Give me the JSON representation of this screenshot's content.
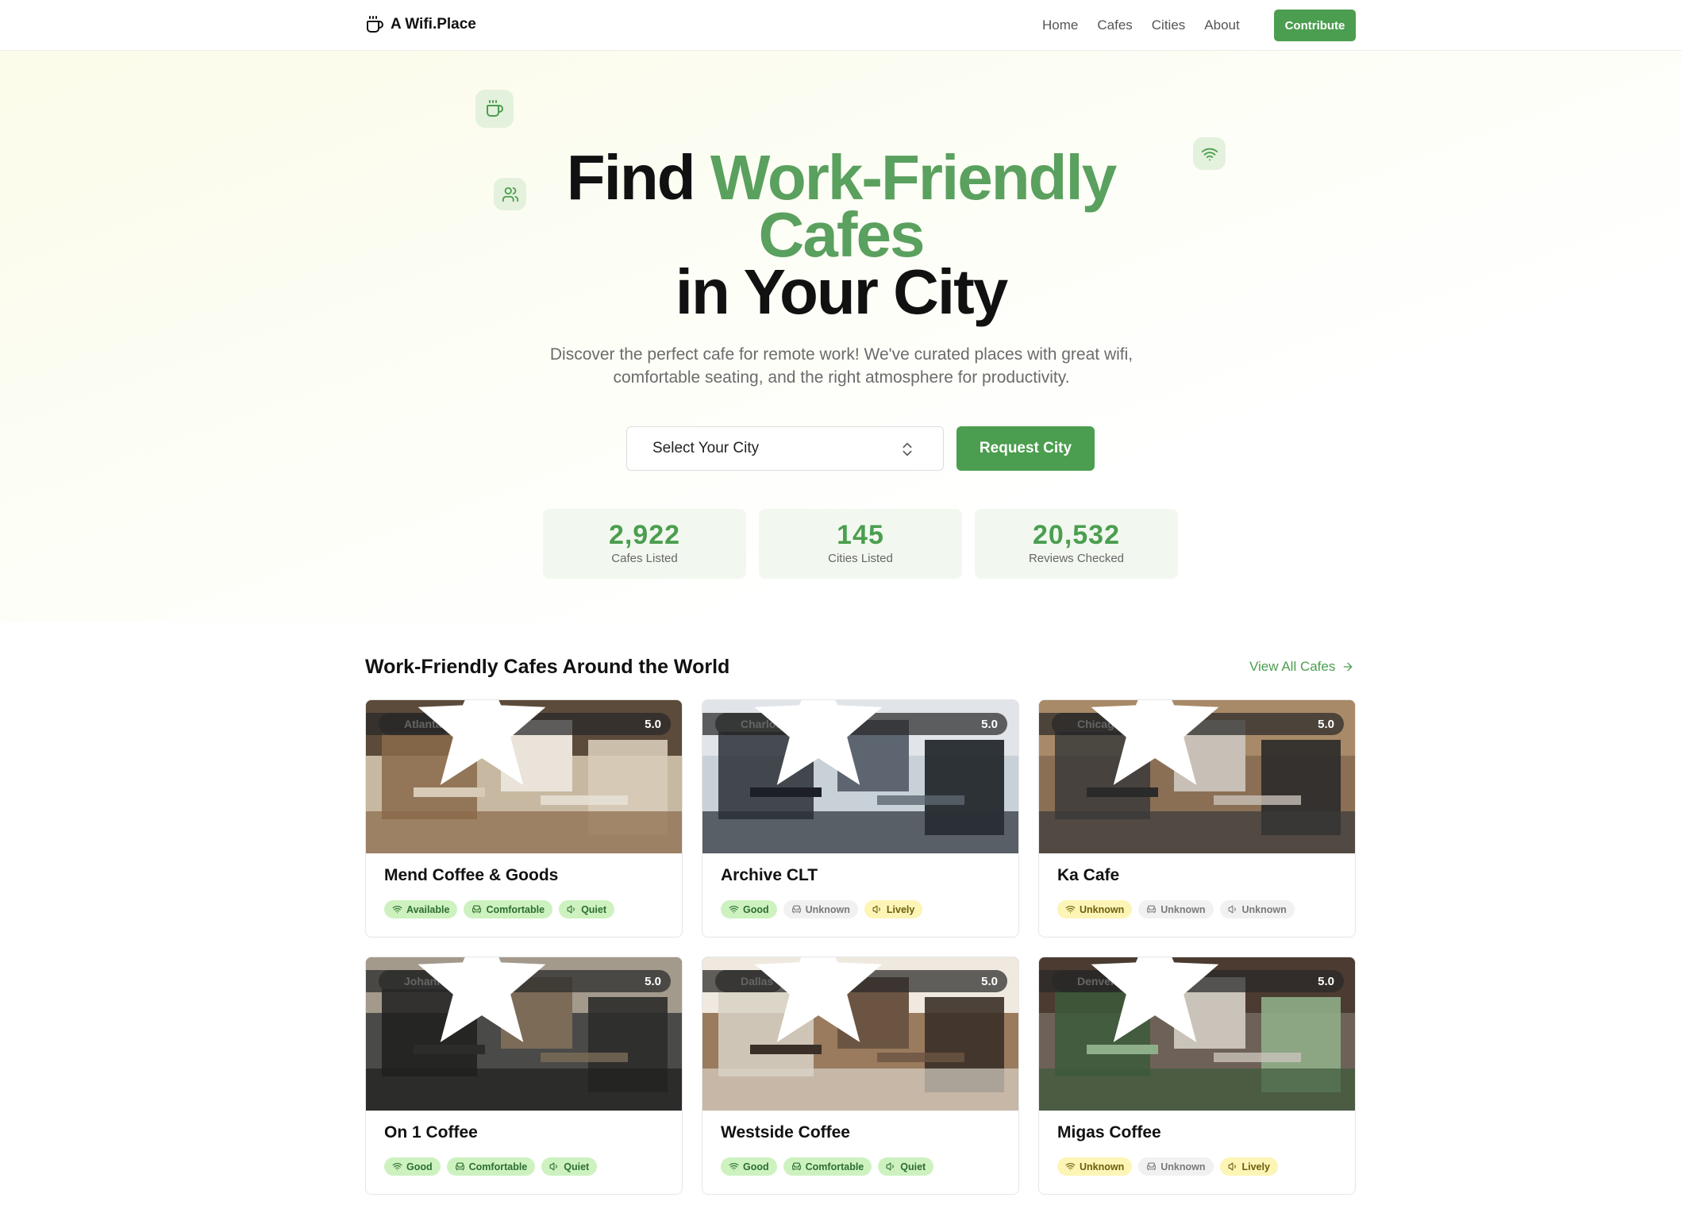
{
  "brand": {
    "name": "A Wifi.Place",
    "icon": "coffee-cup-icon"
  },
  "nav": {
    "items": [
      "Home",
      "Cafes",
      "Cities",
      "About"
    ],
    "contribute_label": "Contribute"
  },
  "hero": {
    "title_line1_dark": "Find ",
    "title_line1_green": "Work-Friendly",
    "title_line2_green": "Cafes",
    "title_line3_dark": "in Your City",
    "subtitle_line1": "Discover the perfect cafe for remote work! We've curated places with great wifi,",
    "subtitle_line2": "comfortable seating, and the right atmosphere for productivity.",
    "city_select_placeholder": "Select Your City",
    "request_label": "Request City",
    "floating_icons": [
      "coffee-cup-icon",
      "users-icon",
      "wifi-icon"
    ]
  },
  "stats": [
    {
      "value": "2,922",
      "label": "Cafes Listed"
    },
    {
      "value": "145",
      "label": "Cities Listed"
    },
    {
      "value": "20,532",
      "label": "Reviews Checked"
    }
  ],
  "section": {
    "title": "Work-Friendly Cafes Around the World",
    "view_all_label": "View All Cafes"
  },
  "cafes": [
    {
      "name": "Mend Coffee & Goods",
      "city": "Atlanta",
      "flag": "us",
      "rating": "5.0",
      "tags": [
        {
          "icon": "wifi-icon",
          "label": "Available",
          "style": "good"
        },
        {
          "icon": "seat-icon",
          "label": "Comfortable",
          "style": "good"
        },
        {
          "icon": "volume-icon",
          "label": "Quiet",
          "style": "good"
        }
      ]
    },
    {
      "name": "Archive CLT",
      "city": "Charlotte",
      "flag": "us",
      "rating": "5.0",
      "tags": [
        {
          "icon": "wifi-icon",
          "label": "Good",
          "style": "good"
        },
        {
          "icon": "seat-icon",
          "label": "Unknown",
          "style": "unknown"
        },
        {
          "icon": "volume-icon",
          "label": "Lively",
          "style": "warn"
        }
      ]
    },
    {
      "name": "Ka Cafe",
      "city": "Chicago",
      "flag": "us",
      "rating": "5.0",
      "tags": [
        {
          "icon": "wifi-icon",
          "label": "Unknown",
          "style": "warn"
        },
        {
          "icon": "seat-icon",
          "label": "Unknown",
          "style": "unknown"
        },
        {
          "icon": "volume-icon",
          "label": "Unknown",
          "style": "unknown"
        }
      ]
    },
    {
      "name": "On 1 Coffee",
      "city": "Johannesburg",
      "flag": "za",
      "rating": "5.0",
      "tags": [
        {
          "icon": "wifi-icon",
          "label": "Good",
          "style": "good"
        },
        {
          "icon": "seat-icon",
          "label": "Comfortable",
          "style": "good"
        },
        {
          "icon": "volume-icon",
          "label": "Quiet",
          "style": "good"
        }
      ]
    },
    {
      "name": "Westside Coffee",
      "city": "Dallas",
      "flag": "us",
      "rating": "5.0",
      "tags": [
        {
          "icon": "wifi-icon",
          "label": "Good",
          "style": "good"
        },
        {
          "icon": "seat-icon",
          "label": "Comfortable",
          "style": "good"
        },
        {
          "icon": "volume-icon",
          "label": "Quiet",
          "style": "good"
        }
      ]
    },
    {
      "name": "Migas Coffee",
      "city": "Denver",
      "flag": "us",
      "rating": "5.0",
      "tags": [
        {
          "icon": "wifi-icon",
          "label": "Unknown",
          "style": "warn"
        },
        {
          "icon": "seat-icon",
          "label": "Unknown",
          "style": "unknown"
        },
        {
          "icon": "volume-icon",
          "label": "Lively",
          "style": "warn"
        }
      ]
    }
  ],
  "colors": {
    "accent": "#4b9e4f",
    "accent_light": "#5aa05e",
    "tag_good_bg": "#cdf2c0",
    "tag_warn_bg": "#fcf5b6",
    "tag_unknown_bg": "#f1f1f1"
  }
}
